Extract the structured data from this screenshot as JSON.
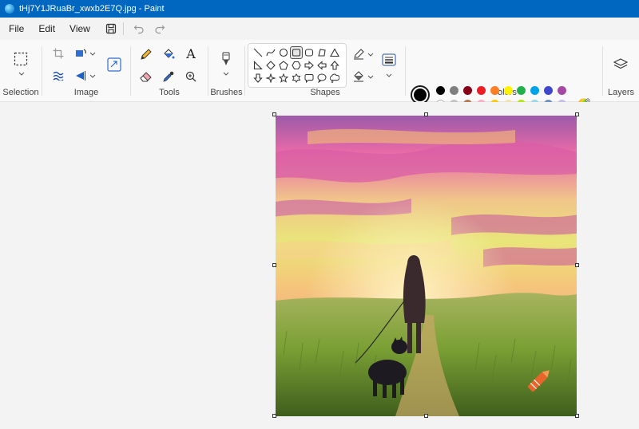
{
  "window": {
    "title": "tHj7Y1JRuaBr_xwxb2E7Q.jpg - Paint"
  },
  "menu": {
    "file": "File",
    "edit": "Edit",
    "view": "View"
  },
  "groups": {
    "selection": "Selection",
    "image": "Image",
    "tools": "Tools",
    "brushes": "Brushes",
    "shapes": "Shapes",
    "colors": "Colors",
    "layers": "Layers"
  },
  "tools": {
    "text_glyph": "A"
  },
  "palette": {
    "primary": "#000000",
    "secondary": "#ffffff",
    "row1": [
      "#000000",
      "#7f7f7f",
      "#880015",
      "#ed1c24",
      "#ff7f27",
      "#fff200",
      "#22b14c",
      "#00a2e8",
      "#3f48cc",
      "#a349a4"
    ],
    "row2": [
      "#ffffff",
      "#c3c3c3",
      "#b97a57",
      "#ffaec9",
      "#ffc90e",
      "#efe4b0",
      "#b5e61d",
      "#99d9ea",
      "#7092be",
      "#c8bfe7"
    ],
    "row3_custom_slots": 10
  },
  "shapes": [
    "line",
    "curve",
    "oval",
    "rectangle",
    "rounded-rectangle",
    "polygon",
    "triangle",
    "right-triangle",
    "diamond",
    "pentagon",
    "hexagon",
    "right-arrow",
    "left-arrow",
    "up-arrow",
    "down-arrow",
    "four-point-star",
    "five-point-star",
    "six-point-star",
    "rounded-callout",
    "oval-callout",
    "cloud-callout",
    "heart"
  ],
  "selected_shape": "rounded-rectangle",
  "canvas_image": "painted landscape: woman walking dog at sunset in a grassy field"
}
